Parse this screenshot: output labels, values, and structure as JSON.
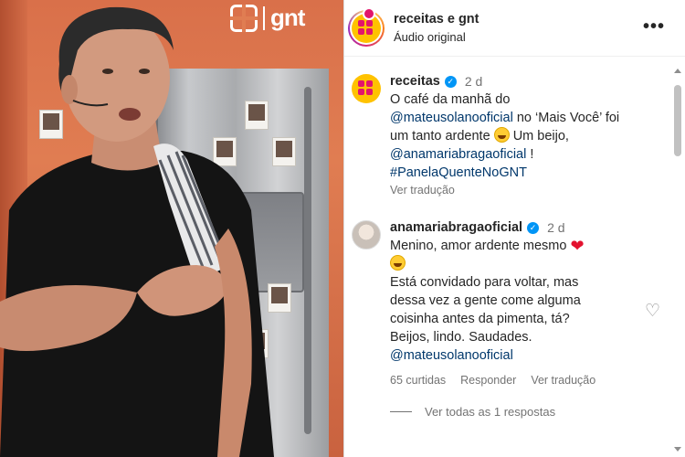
{
  "media": {
    "logo_text": "gnt",
    "logo_icon": "gnt-logo-icon",
    "background_color": "#e07d52"
  },
  "header": {
    "account_name": "receitas e gnt",
    "subtitle": "Áudio original",
    "more_icon": "more-horizontal-icon"
  },
  "comments": [
    {
      "username": "receitas",
      "verified": true,
      "time": "2 d",
      "lines": [
        {
          "text": "O café da manhã do"
        },
        {
          "mention": "@mateusolanooficial",
          "text": " no ‘Mais Você’ foi"
        },
        {
          "text": "um tanto ardente ",
          "emoji": "laughing-emoji",
          "text_after": " Um beijo,"
        },
        {
          "mention": "@anamariabragaoficial",
          "text": " !"
        },
        {
          "mention": "#PanelaQuenteNoGNT"
        }
      ],
      "translate_label": "Ver tradução"
    },
    {
      "username": "anamariabragaoficial",
      "verified": true,
      "time": "2 d",
      "lines": [
        {
          "text": "Menino, amor ardente mesmo ",
          "emoji": "red-heart-emoji"
        },
        {
          "emoji": "laughing-emoji"
        },
        {
          "text": "Está convidado para voltar, mas"
        },
        {
          "text": "dessa vez a gente come alguma"
        },
        {
          "text": "coisinha antes da pimenta, tá?"
        },
        {
          "text": "Beijos, lindo. Saudades."
        },
        {
          "mention": "@mateusolanooficial"
        }
      ],
      "likes_label": "65 curtidas",
      "reply_label": "Responder",
      "translate_label": "Ver tradução",
      "view_replies_label": "Ver todas as 1 respostas"
    }
  ],
  "colors": {
    "accent": "#0095f6",
    "mention": "#00376b",
    "muted": "#737373",
    "brand": "#ffc200",
    "heart": "#e3122f"
  }
}
